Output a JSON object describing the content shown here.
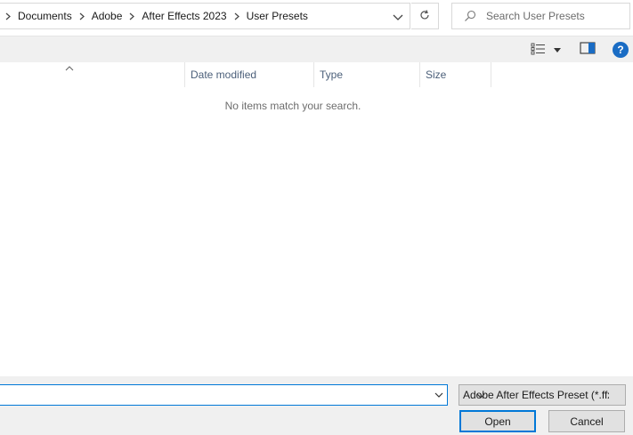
{
  "breadcrumb": {
    "items": [
      {
        "label": "Documents"
      },
      {
        "label": "Adobe"
      },
      {
        "label": "After Effects 2023"
      },
      {
        "label": "User Presets"
      }
    ]
  },
  "search": {
    "placeholder": "Search User Presets"
  },
  "toolbar": {
    "help_label": "?"
  },
  "list": {
    "columns": [
      {
        "label": ""
      },
      {
        "label": "Date modified"
      },
      {
        "label": "Type"
      },
      {
        "label": "Size"
      }
    ],
    "empty_message": "No items match your search."
  },
  "footer": {
    "filename_value": "",
    "filetype_selected": "Adobe After Effects Preset (*.ffx)",
    "open_label": "Open",
    "cancel_label": "Cancel"
  },
  "colors": {
    "accent": "#0078d7",
    "help": "#1a6cc4",
    "header_text": "#4c607a"
  }
}
